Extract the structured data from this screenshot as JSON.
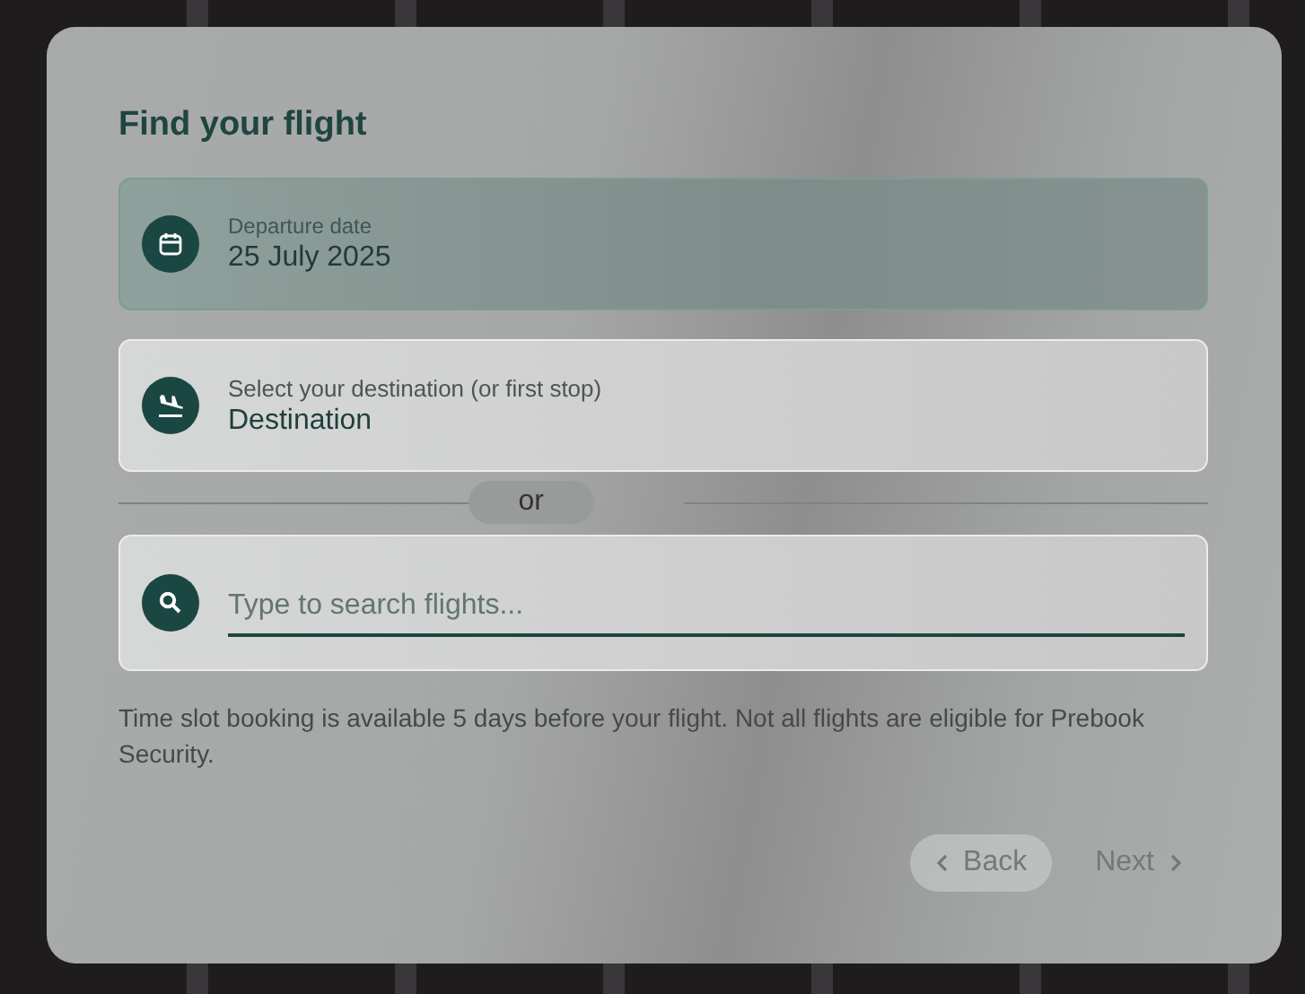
{
  "title": "Find your flight",
  "fields": [
    {
      "kind": "date",
      "label": "Departure date",
      "value": "25 July 2025",
      "active": true
    },
    {
      "kind": "destination",
      "label": "Select your destination (or first stop)",
      "value": "Destination",
      "active": false
    }
  ],
  "divider": "or",
  "search": {
    "placeholder": "Type to search flights..."
  },
  "note": "Time slot booking is available 5 days before your flight. Not all flights are eligible for Prebook Security.",
  "buttons": [
    {
      "kind": "back",
      "label": "Back",
      "disabled": true
    },
    {
      "kind": "next",
      "label": "Next",
      "disabled": true
    }
  ]
}
